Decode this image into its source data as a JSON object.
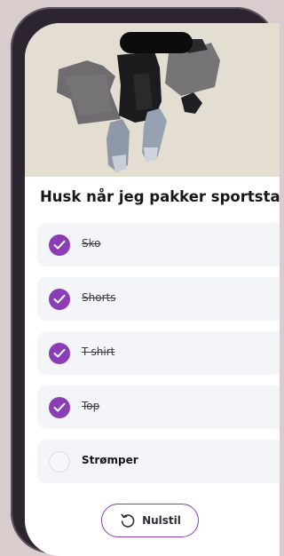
{
  "page": {
    "title": "Husk når jeg pakker sportstaske"
  },
  "items": [
    {
      "label": "Sko",
      "checked": true
    },
    {
      "label": "Shorts",
      "checked": true
    },
    {
      "label": "T-shirt",
      "checked": true
    },
    {
      "label": "Top",
      "checked": true
    },
    {
      "label": "Strømper",
      "checked": false
    }
  ],
  "reset_button": {
    "label": "Nulstil",
    "icon": "reset-icon"
  },
  "colors": {
    "accent": "#8b3db6",
    "item_bg": "#f4f5f9",
    "title": "#17161d"
  }
}
